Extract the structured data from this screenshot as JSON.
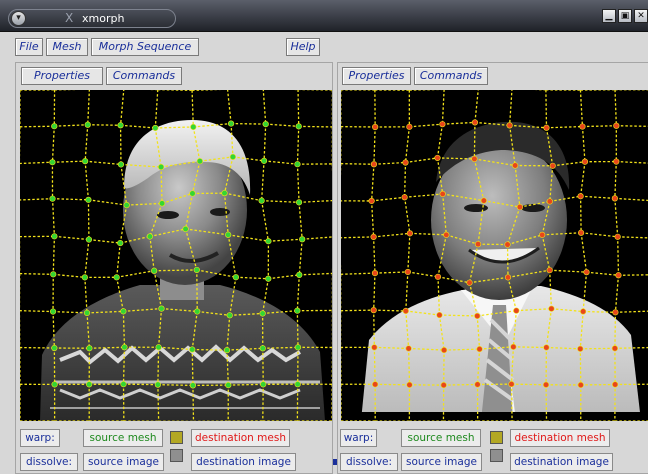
{
  "window": {
    "title": "xmorph",
    "menu_glyph": "▾",
    "app_glyph": "X",
    "controls": [
      {
        "name": "minimize-button",
        "icon": "minimize-icon",
        "glyph": "▁"
      },
      {
        "name": "maximize-button",
        "icon": "maximize-icon",
        "glyph": "▣"
      },
      {
        "name": "close-button",
        "icon": "close-icon",
        "glyph": "✕"
      }
    ]
  },
  "menubar": {
    "file": "File",
    "mesh": "Mesh",
    "morph_sequence": "Morph Sequence",
    "help": "Help"
  },
  "panels": [
    {
      "id": "source",
      "properties": "Properties",
      "commands": "Commands",
      "warp_label": "warp:",
      "dissolve_label": "dissolve:",
      "source_mesh": "source mesh",
      "destination_mesh": "destination mesh",
      "source_image": "source image",
      "destination_image": "destination image"
    },
    {
      "id": "destination",
      "properties": "Properties",
      "commands": "Commands",
      "warp_label": "warp:",
      "dissolve_label": "dissolve:",
      "source_mesh": "source mesh",
      "destination_mesh": "destination mesh",
      "source_image": "source image",
      "destination_image": "destination image"
    }
  ],
  "colors": {
    "label_blue": "#1a2f9a",
    "source_mesh_green": "#1f8a1f",
    "destination_mesh_red": "#e01818",
    "mesh_line_yellow": "#f2e21a",
    "source_node_green": "#33d633",
    "destination_node_red": "#e8461a",
    "warp_swatch": "#b3a824",
    "dissolve_swatch": "#8f8f8f"
  }
}
